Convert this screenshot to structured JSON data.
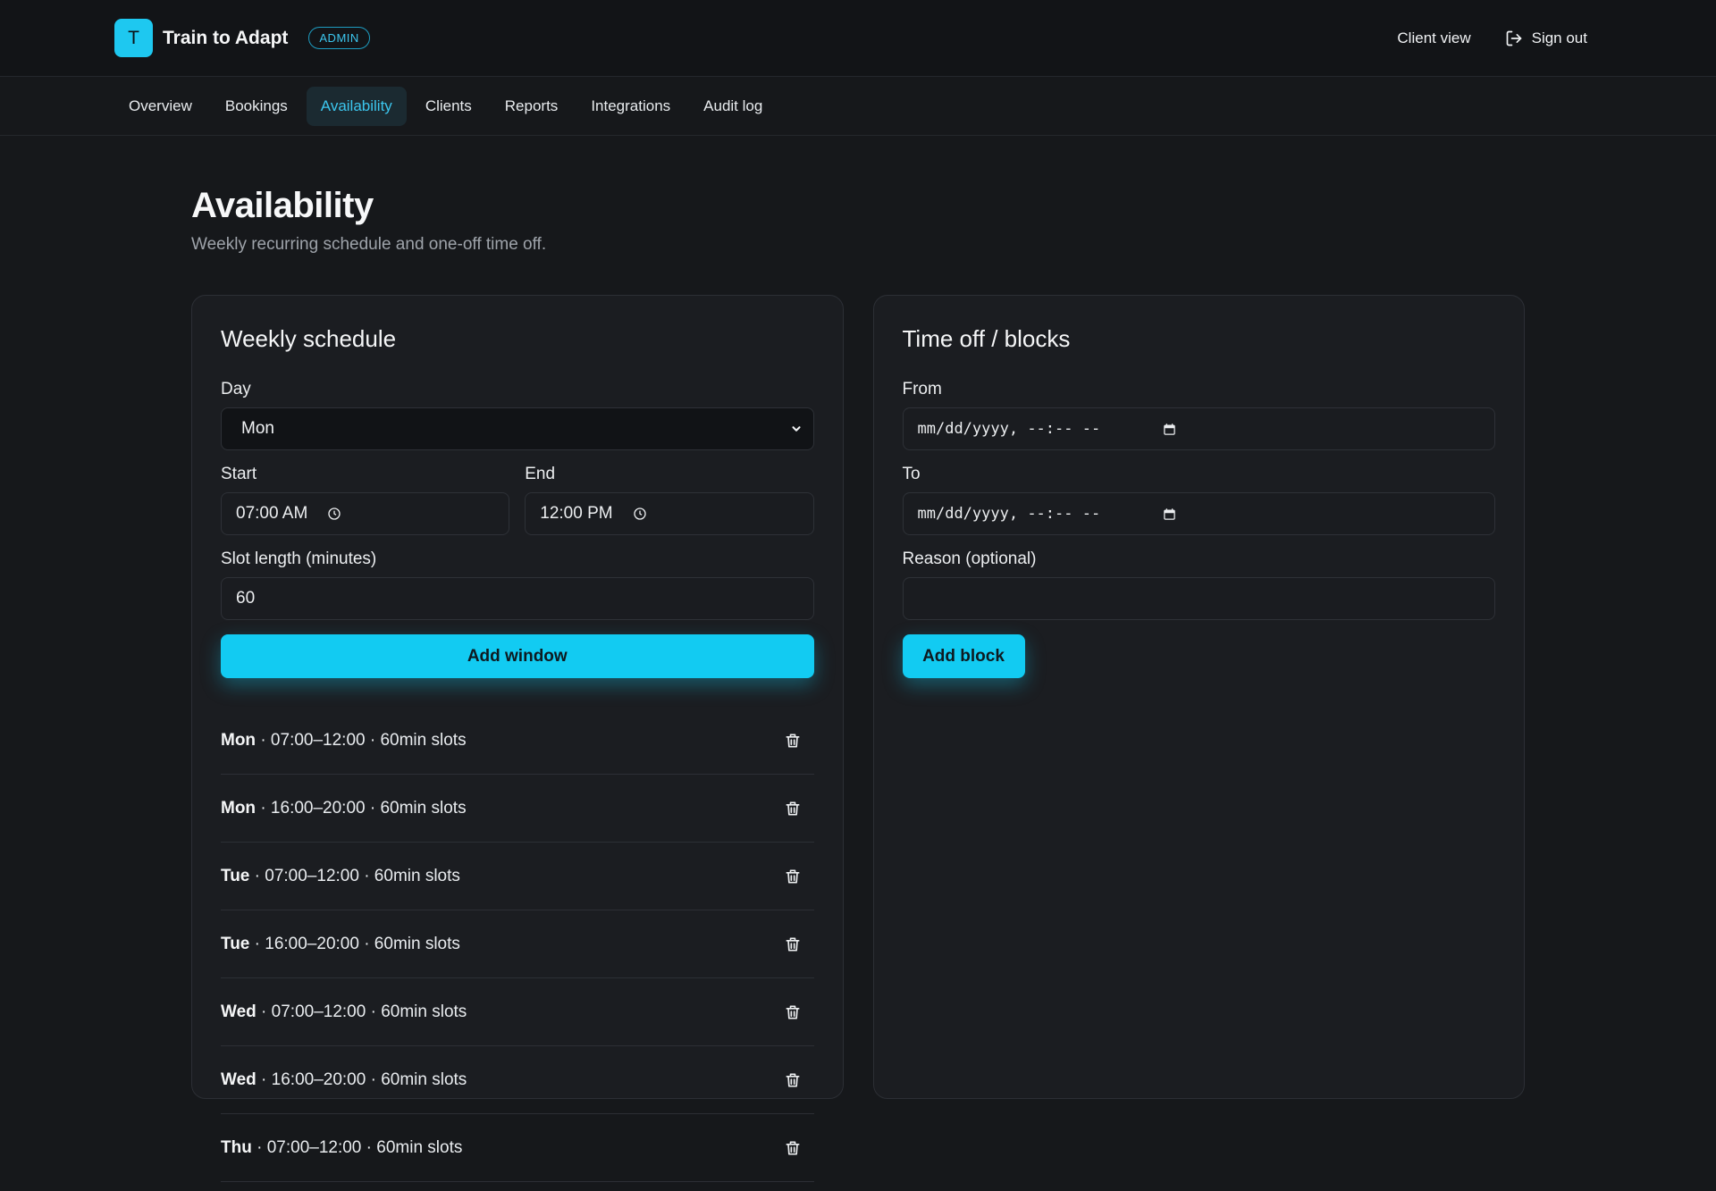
{
  "header": {
    "logo_letter": "T",
    "brand_name": "Train to Adapt",
    "badge": "ADMIN",
    "client_view": "Client view",
    "sign_out": "Sign out"
  },
  "nav": {
    "tabs": [
      {
        "label": "Overview"
      },
      {
        "label": "Bookings"
      },
      {
        "label": "Availability"
      },
      {
        "label": "Clients"
      },
      {
        "label": "Reports"
      },
      {
        "label": "Integrations"
      },
      {
        "label": "Audit log"
      }
    ],
    "active": "Availability"
  },
  "page": {
    "title": "Availability",
    "subtitle": "Weekly recurring schedule and one-off time off."
  },
  "weekly": {
    "title": "Weekly schedule",
    "day_label": "Day",
    "day_value": "Mon",
    "start_label": "Start",
    "start_value": "07:00 AM",
    "end_label": "End",
    "end_value": "12:00 PM",
    "slot_label": "Slot length (minutes)",
    "slot_value": "60",
    "add_button": "Add window",
    "windows": [
      {
        "day": "Mon",
        "detail": " · 07:00–12:00 · 60min slots"
      },
      {
        "day": "Mon",
        "detail": " · 16:00–20:00 · 60min slots"
      },
      {
        "day": "Tue",
        "detail": " · 07:00–12:00 · 60min slots"
      },
      {
        "day": "Tue",
        "detail": " · 16:00–20:00 · 60min slots"
      },
      {
        "day": "Wed",
        "detail": " · 07:00–12:00 · 60min slots"
      },
      {
        "day": "Wed",
        "detail": " · 16:00–20:00 · 60min slots"
      },
      {
        "day": "Thu",
        "detail": " · 07:00–12:00 · 60min slots"
      }
    ]
  },
  "timeoff": {
    "title": "Time off / blocks",
    "from_label": "From",
    "from_placeholder": "mm/dd/yyyy, --:-- --",
    "to_label": "To",
    "to_placeholder": "mm/dd/yyyy, --:-- --",
    "reason_label": "Reason (optional)",
    "reason_value": "",
    "add_button": "Add block"
  },
  "colors": {
    "accent": "#12cbf2",
    "background": "#16181b",
    "card": "#1b1d21"
  },
  "icons": {
    "signout": "sign-out-icon",
    "select": "chevron-down-icon",
    "time": "clock-icon",
    "date": "calendar-icon",
    "delete": "trash-icon"
  }
}
